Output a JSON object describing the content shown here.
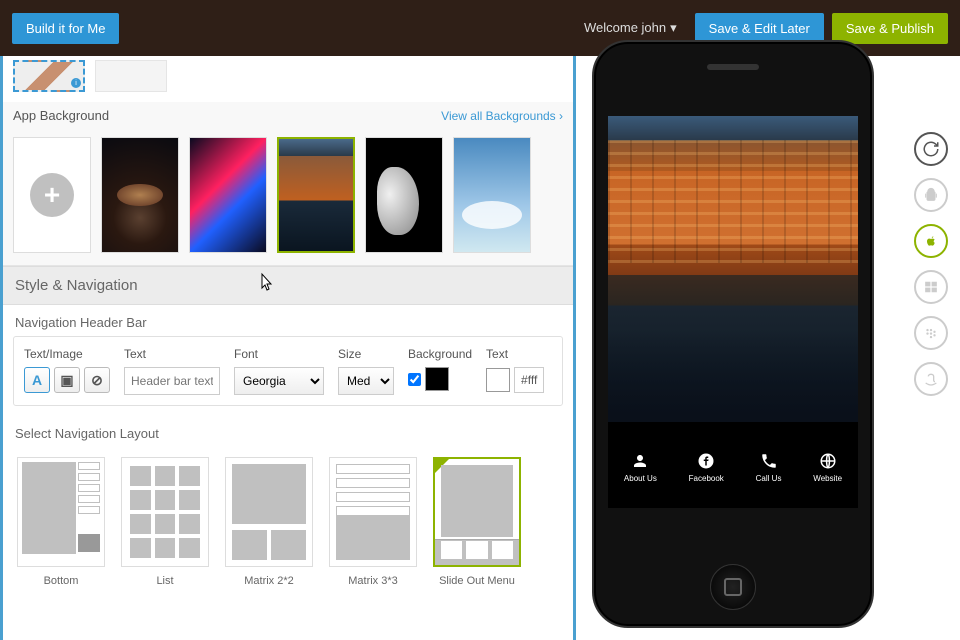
{
  "topbar": {
    "build_label": "Build it for Me",
    "welcome": "Welcome john",
    "save_edit_label": "Save & Edit Later",
    "save_publish_label": "Save & Publish"
  },
  "background": {
    "section_label": "App Background",
    "view_all_label": "View all Backgrounds ›"
  },
  "style_nav": {
    "header": "Style & Navigation",
    "sub_label": "Navigation Header Bar",
    "textimage_label": "Text/Image",
    "text_label": "Text",
    "text_placeholder": "Header bar text",
    "font_label": "Font",
    "font_value": "Georgia",
    "size_label": "Size",
    "size_value": "Med",
    "bg_label": "Background",
    "txt_label": "Text",
    "txt_color": "#fff"
  },
  "layouts": {
    "section_label": "Select Navigation Layout",
    "items": [
      {
        "label": "Bottom"
      },
      {
        "label": "List"
      },
      {
        "label": "Matrix 2*2"
      },
      {
        "label": "Matrix 3*3"
      },
      {
        "label": "Slide Out Menu"
      }
    ]
  },
  "preview": {
    "tabs": [
      {
        "label": "About Us"
      },
      {
        "label": "Facebook"
      },
      {
        "label": "Call Us"
      },
      {
        "label": "Website"
      }
    ]
  }
}
